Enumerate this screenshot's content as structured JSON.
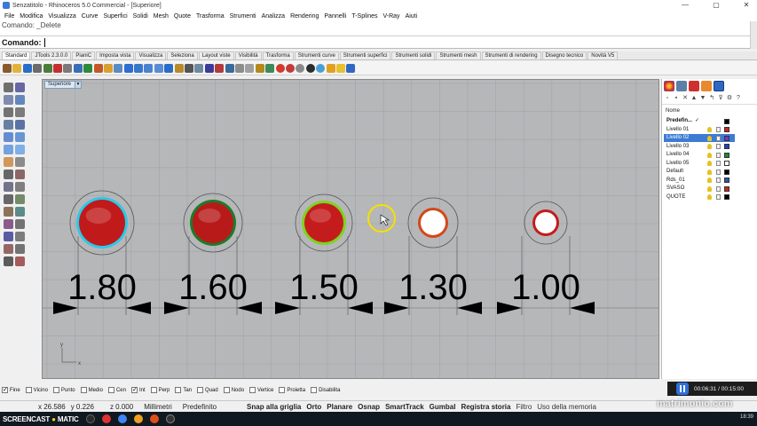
{
  "window": {
    "title": "Senzatitolo - Rhinoceros 5.0 Commercial - [Superiore]",
    "minimize": "—",
    "maximize": "▢",
    "close": "✕"
  },
  "menu": [
    "File",
    "Modifica",
    "Visualizza",
    "Curve",
    "Superfici",
    "Solidi",
    "Mesh",
    "Quote",
    "Trasforma",
    "Strumenti",
    "Analizza",
    "Rendering",
    "Pannelli",
    "T-Splines",
    "V-Ray",
    "Aiuti"
  ],
  "command": {
    "history": "Comando: _Delete",
    "prompt": "Comando:"
  },
  "toolbar_tabs": [
    "Standard",
    "JTools 2.3.0.0",
    "PianiC",
    "Imposta vista",
    "Visualizza",
    "Seleziona",
    "Layout viste",
    "Visibilità",
    "Trasforma",
    "Strumenti curve",
    "Strumenti superfici",
    "Strumenti solidi",
    "Strumenti mesh",
    "Strumenti di rendering",
    "Disegno tecnico",
    "Novità V5"
  ],
  "toolbar_icons": [
    "new-file",
    "open",
    "save",
    "print",
    "import",
    "cut",
    "copy",
    "paste",
    "undo",
    "redo",
    "pan-hand",
    "rotate-view",
    "zoom-in",
    "zoom-window",
    "zoom-extents",
    "zoom-selected",
    "zoom-all",
    "pan",
    "four-viewports",
    "grid",
    "select",
    "layer",
    "properties",
    "hide",
    "show",
    "lock",
    "unlock",
    "render-color",
    "material",
    "shaded",
    "rendered",
    "environment",
    "sun",
    "light",
    "help"
  ],
  "left_tools": [
    "select-arrow",
    "point",
    "polyline",
    "circle",
    "arc",
    "rectangle",
    "polygon",
    "curve",
    "box",
    "sphere",
    "surface",
    "extrude",
    "boolean",
    "fillet",
    "join",
    "explode",
    "trim",
    "split",
    "move",
    "rotate",
    "scale",
    "mirror",
    "array",
    "group",
    "dimension",
    "text",
    "hatch",
    "ungroup",
    "analyze",
    "snapshot"
  ],
  "viewport": {
    "label": "Superiore",
    "dropdown": "▼",
    "axis_x": "x",
    "axis_y": "y"
  },
  "circles": [
    {
      "dimension": "1.80",
      "fill": "#c01a1a",
      "outline": "#2ec8e8"
    },
    {
      "dimension": "1.60",
      "fill": "#b81a1a",
      "outline": "#1f7a2a"
    },
    {
      "dimension": "1.50",
      "fill": "#c41c1c",
      "outline": "#7ed321"
    },
    {
      "dimension": "1.30",
      "fill": "#ffffff",
      "outline": "#d4471a"
    },
    {
      "dimension": "1.00",
      "fill": "#ffffff",
      "outline": "#c41c1c"
    }
  ],
  "layers": {
    "header": "Nome",
    "rows": [
      {
        "name": "Predefin...",
        "check": "✓",
        "color": "#000000",
        "bold": true,
        "selected": false
      },
      {
        "name": "Livello 01",
        "color": "#d42020",
        "bold": false,
        "selected": false
      },
      {
        "name": "Livello 02",
        "color": "#7a33cc",
        "bold": false,
        "selected": true
      },
      {
        "name": "Livello 03",
        "color": "#1f3fcf",
        "bold": false,
        "selected": false
      },
      {
        "name": "Livello 04",
        "color": "#1f8a2a",
        "bold": false,
        "selected": false
      },
      {
        "name": "Livello 05",
        "color": "#ffffff",
        "bold": false,
        "selected": false
      },
      {
        "name": "Default",
        "color": "#000000",
        "bold": false,
        "selected": false
      },
      {
        "name": "Rds_01",
        "color": "#2a55b0",
        "bold": false,
        "selected": false
      },
      {
        "name": "SVASO",
        "color": "#d42020",
        "bold": false,
        "selected": false
      },
      {
        "name": "QUOTE",
        "color": "#000000",
        "bold": false,
        "selected": false
      }
    ]
  },
  "osnaps": [
    {
      "label": "Fine",
      "checked": true
    },
    {
      "label": "Vicino",
      "checked": false
    },
    {
      "label": "Punto",
      "checked": false
    },
    {
      "label": "Medio",
      "checked": false
    },
    {
      "label": "Cen",
      "checked": false
    },
    {
      "label": "Int",
      "checked": true
    },
    {
      "label": "Perp",
      "checked": false
    },
    {
      "label": "Tan",
      "checked": false
    },
    {
      "label": "Quad",
      "checked": false
    },
    {
      "label": "Nodo",
      "checked": false
    },
    {
      "label": "Vertice",
      "checked": false
    },
    {
      "label": "Proietta",
      "checked": false
    },
    {
      "label": "Disabilita",
      "checked": false
    }
  ],
  "recorder": {
    "time": "00:06:31 / 00:15:00"
  },
  "status": {
    "coords_x": "x 26.586",
    "coords_y": "y 0.226",
    "coords_z": "z 0.000",
    "units": "Millimetri",
    "layer": "Predefinito",
    "snap": "Snap alla griglia",
    "orto": "Orto",
    "planare": "Planare",
    "osnap": "Osnap",
    "smarttrack": "SmartTrack",
    "gumball": "Gumbal",
    "history": "Registra storia",
    "filter": "Filtro",
    "memory": "Uso della memoria"
  },
  "taskbar": {
    "brand_a": "SCREENCAST",
    "brand_b": "MATIC",
    "clock": "18:39",
    "watermark": "matrimonio.com"
  }
}
